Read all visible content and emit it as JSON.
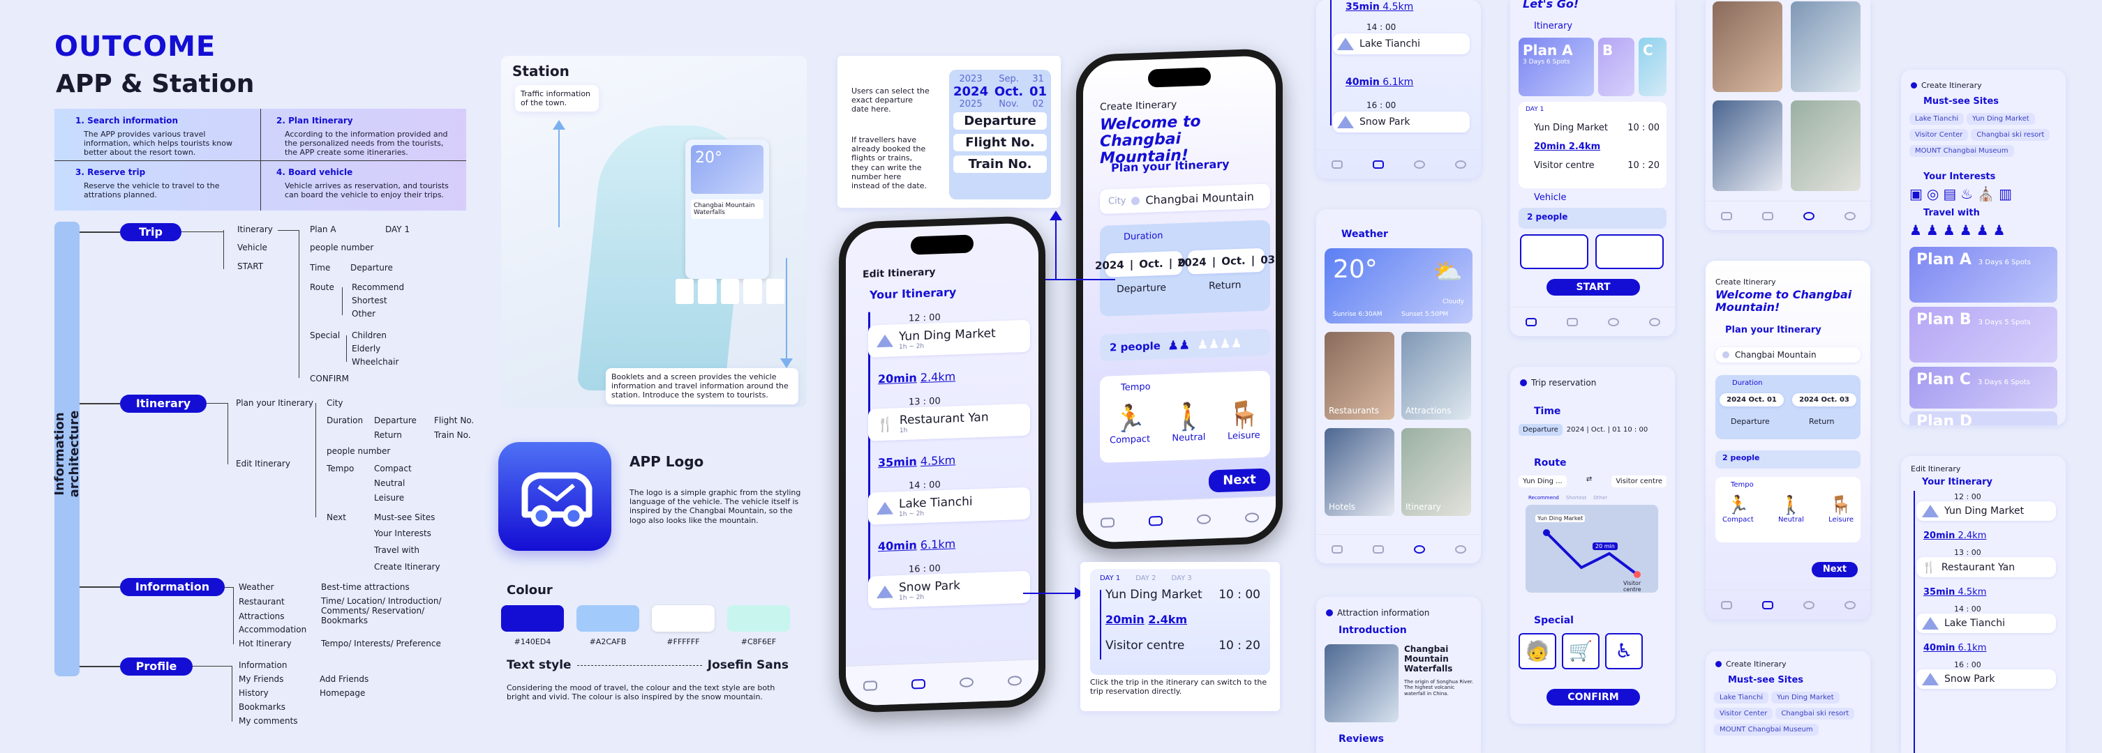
{
  "header": {
    "outcome": "OUTCOME",
    "subtitle": "APP & Station"
  },
  "intro": [
    {
      "title": "1. Search information",
      "body": "The APP provides various travel information, which helps tourists know better about the resort town."
    },
    {
      "title": "2. Plan Itinerary",
      "body": "According to the information provided and the personalized needs from the tourists, the APP create some itineraries."
    },
    {
      "title": "3. Reserve trip",
      "body": "Reserve the vehicle to travel to the attrations planned."
    },
    {
      "title": "4. Board vehicle",
      "body": "Vehicle arrives as reservation, and tourists can board the vehicle to enjoy their trips."
    }
  ],
  "ia": {
    "side_label": "Information architecture",
    "trip": {
      "label": "Trip",
      "items": [
        "Itinerary",
        "Vehicle",
        "START"
      ],
      "plan": "Plan A",
      "day": "DAY 1",
      "people": "people number",
      "time": "Time",
      "departure": "Departure",
      "route": "Route",
      "route_opts": [
        "Recommend",
        "Shortest",
        "Other"
      ],
      "special": "Special",
      "special_opts": [
        "Children",
        "Elderly",
        "Wheelchair"
      ],
      "confirm": "CONFIRM"
    },
    "itinerary": {
      "label": "Itinerary",
      "plan": "Plan your Itinerary",
      "edit": "Edit Itinerary",
      "city": "City",
      "duration": "Duration",
      "departure": "Departure",
      "return": "Return",
      "flight": "Flight No.",
      "train": "Train No.",
      "people": "people number",
      "tempo": "Tempo",
      "tempo_opts": [
        "Compact",
        "Neutral",
        "Leisure"
      ],
      "next": "Next",
      "next_opts": [
        "Must-see Sites",
        "Your Interests",
        "Travel with",
        "Create Itinerary"
      ]
    },
    "information": {
      "label": "Information",
      "items": [
        "Weather",
        "Restaurant",
        "Attractions",
        "Accommodation",
        "Hot Itinerary"
      ],
      "weather_detail": "Best-time attractions",
      "restaurant_detail": "Time/ Location/ Introduction/ Comments/ Reservation/ Bookmarks",
      "hot_detail": "Tempo/ Interests/ Preference"
    },
    "profile": {
      "label": "Profile",
      "items": [
        "Information",
        "My Friends",
        "History",
        "Bookmarks",
        "My comments"
      ],
      "friends_opts": [
        "Add Friends",
        "Homepage"
      ]
    }
  },
  "station": {
    "title": "Station",
    "traffic": "Traffic information of the town.",
    "booklets": "Booklets and a screen provides the vehicle information and travel information around the station. Introduce the system to tourists.",
    "screen_temp": "20°",
    "screen_title": "Changbai Mountain Waterfalls"
  },
  "logo": {
    "title": "APP Logo",
    "body": "The logo is a simple graphic from the styling language of the vehicle. The vehicle itself is inspired by the Changbai Mountain, so the logo also looks like the mountain."
  },
  "colour": {
    "title": "Colour",
    "swatches": [
      {
        "hex": "#140ED4",
        "label": "#140ED4"
      },
      {
        "hex": "#A2CAFB",
        "label": "#A2CAFB"
      },
      {
        "hex": "#FFFFFF",
        "label": "#FFFFFF"
      },
      {
        "hex": "#C8F6EF",
        "label": "#C8F6EF"
      }
    ]
  },
  "textstyle": {
    "label": "Text style",
    "font": "Josefin Sans",
    "body": "Considering the mood of travel, the colour and the text style are both bright and vivid. The colour is also inspired by the snow mountain."
  },
  "date_note": {
    "select": "Users can select the exact departure date here.",
    "booked": "If travellers have already booked the flights or trains, they can write the number here instead of the date.",
    "years": [
      "2023",
      "2024",
      "2025"
    ],
    "months": [
      "Sep.",
      "Oct.",
      "Nov."
    ],
    "days": [
      "31",
      "01",
      "02"
    ],
    "departure": "Departure",
    "flight": "Flight No.",
    "train": "Train No."
  },
  "edit_phone": {
    "header": "Edit Itinerary",
    "section": "Your Itinerary",
    "stops": [
      {
        "time": "12 : 00",
        "name": "Yun Ding Market",
        "dur": "1h ~ 2h"
      },
      {
        "leg": "20min",
        "dist": "2.4km"
      },
      {
        "time": "13 : 00",
        "name": "Restaurant Yan",
        "dur": "1h"
      },
      {
        "leg": "35min",
        "dist": "4.5km"
      },
      {
        "time": "14 : 00",
        "name": "Lake Tianchi",
        "dur": "1h ~ 2h"
      },
      {
        "leg": "40min",
        "dist": "6.1km"
      },
      {
        "time": "16 : 00",
        "name": "Snow Park",
        "dur": "1h ~ 2h"
      }
    ]
  },
  "create_phone": {
    "header": "Create Itinerary",
    "welcome": "Welcome to Changbai Mountain!",
    "section": "Plan your Itinerary",
    "city_label": "City",
    "city": "Changbai Mountain",
    "duration": "Duration",
    "dep_year": "2024",
    "dep_month": "Oct.",
    "dep_day": "01",
    "dep_label": "Departure",
    "ret_year": "2024",
    "ret_month": "Oct.",
    "ret_day": "03",
    "ret_label": "Return",
    "people": "2 people",
    "tempo": "Tempo",
    "tempo_opts": [
      "Compact",
      "Neutral",
      "Leisure"
    ],
    "next": "Next"
  },
  "trip_card": {
    "days": [
      "DAY 1",
      "DAY 2",
      "DAY 3"
    ],
    "from": "Yun Ding Market",
    "from_time": "10 : 00",
    "leg": "20min",
    "dist": "2.4km",
    "to": "Visitor centre",
    "to_time": "10 : 20",
    "caption": "Click the trip in the itinerary can switch to the trip reservation directly."
  },
  "col1": {
    "top_leg": "35min",
    "top_dist": "4.5km",
    "time1": "14 : 00",
    "name1": "Lake Tianchi",
    "leg2": "40min",
    "dist2": "6.1km",
    "time2": "16 : 00",
    "name2": "Snow Park",
    "weather": "Weather",
    "temp": "20°",
    "cloud": "Cloudy",
    "sunrise": "Sunrise 6:30AM",
    "sunset": "Sunset 5:50PM",
    "tiles": [
      "Restaurants",
      "Attractions",
      "Hotels",
      "Itinerary"
    ],
    "attr_header": "Attraction information",
    "intro": "Introduction",
    "attr_name": "Changbai Mountain Waterfalls",
    "attr_body": "The origin of Songhua River. The highest volcanic waterfall in China.",
    "reviews": "Reviews"
  },
  "col2": {
    "go": "Let's Go!",
    "itinerary": "Itinerary",
    "plans": [
      "Plan A",
      "B",
      "C"
    ],
    "plan_meta": "3 Days  6 Spots",
    "day": "DAY 1",
    "from": "Yun Ding Market",
    "from_time": "10 : 00",
    "leg": "20min",
    "dist": "2.4km",
    "to": "Visitor centre",
    "to_time": "10 : 20",
    "vehicle": "Vehicle",
    "people": "2 people",
    "start": "START",
    "res_header": "Trip reservation",
    "time": "Time",
    "dep": "Departure",
    "dep_val": "2024 | Oct. | 01   10 : 00",
    "route": "Route",
    "route_from": "Yun Ding ...",
    "route_to": "Visitor centre",
    "route_opts": [
      "Recommend",
      "Shortest",
      "Other"
    ],
    "map_start": "Yun Ding Market",
    "map_end": "Visitor centre",
    "map_time": "20 min",
    "special": "Special",
    "confirm": "CONFIRM"
  },
  "col3": {
    "create": "Create Itinerary",
    "welcome": "Welcome to Changbai Mountain!",
    "plan": "Plan your Itinerary",
    "city": "Changbai Mountain",
    "duration": "Duration",
    "dep": "2024 Oct. 01",
    "ret": "2024 Oct. 03",
    "dep_label": "Departure",
    "ret_label": "Return",
    "people": "2 people",
    "tempo": "Tempo",
    "tempo_opts": [
      "Compact",
      "Neutral",
      "Leisure"
    ],
    "next": "Next",
    "create2": "Create Itinerary",
    "must": "Must-see Sites",
    "chips": [
      "Lake Tianchi",
      "Yun Ding Market",
      "Visitor Center",
      "Changbai ski resort",
      "MOUNT Changbai Museum"
    ]
  },
  "col4": {
    "create": "Create Itinerary",
    "must": "Must-see Sites",
    "chips": [
      "Lake Tianchi",
      "Yun Ding Market",
      "Visitor Center",
      "Changbai ski resort",
      "MOUNT Changbai Museum"
    ],
    "interests": "Your Interests",
    "travel": "Travel with",
    "plans": [
      {
        "name": "Plan A",
        "meta": "3 Days  6 Spots"
      },
      {
        "name": "Plan B",
        "meta": "3 Days  5 Spots"
      },
      {
        "name": "Plan C",
        "meta": "3 Days  6 Spots"
      },
      {
        "name": "Plan D",
        "meta": ""
      }
    ],
    "edit": "Edit Itinerary",
    "your": "Your Itinerary",
    "stops": [
      {
        "time": "12 : 00",
        "name": "Yun Ding Market"
      },
      {
        "leg": "20min",
        "dist": "2.4km"
      },
      {
        "time": "13 : 00",
        "name": "Restaurant Yan"
      },
      {
        "leg": "35min",
        "dist": "4.5km"
      },
      {
        "time": "14 : 00",
        "name": "Lake Tianchi"
      },
      {
        "leg": "40min",
        "dist": "6.1km"
      },
      {
        "time": "16 : 00",
        "name": "Snow Park"
      }
    ]
  }
}
